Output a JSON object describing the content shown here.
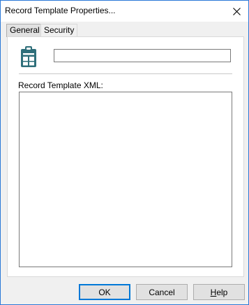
{
  "window": {
    "title": "Record Template Properties..."
  },
  "tabs": [
    {
      "label": "General",
      "active": true
    },
    {
      "label": "Security",
      "active": false
    }
  ],
  "general": {
    "icon": "clipboard-icon",
    "name_value": "",
    "xml_label": "Record Template XML:",
    "xml_value": ""
  },
  "buttons": {
    "ok_label": "OK",
    "cancel_label": "Cancel",
    "help_label": "Help"
  },
  "colors": {
    "accent": "#0078d7",
    "icon": "#2f6f7a"
  }
}
